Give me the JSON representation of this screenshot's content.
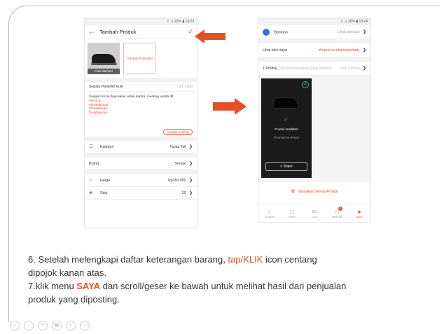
{
  "phone1": {
    "status": "⇪ ⊿ 22% ▮ 13:23",
    "title": "Tambah Produk",
    "photo_caption": "Foto Sampul",
    "add_photo_label": "+ Tambah Foto/Video",
    "product_name": "Sepatu Pantofel Kulit",
    "name_count": "21 / 100",
    "description_text": "Sangat cocok digunakan untuk kantor, meeting, pesta dll",
    "hashtags": [
      "#produk",
      "#produklokal",
      "#lewatkaupo",
      "#wajibpunya"
    ],
    "hashtag_button": "Tambah Hashtag",
    "category_label": "Kategori",
    "category_value": "Tanpa Tali",
    "brand_label": "Brand",
    "brand_value": "Senasi",
    "price_label": "Harga",
    "price_value": "Rp350.000",
    "stock_label": "Stok",
    "stock_value": "20"
  },
  "phone2": {
    "status": "⇪ ⊿ 20% ▮ 13:24",
    "help_label": "Bantuan",
    "help_link": "Lihat bantuan",
    "view_store_label": "Lihat toko saya",
    "view_store_link": "shopee.co.id/annimulanty",
    "products_label": "1 Produk",
    "products_hint": "(Jika terhubungkan yang terbaru)",
    "products_link": "Lihat Semua",
    "success_title": "Produk terdaftar!",
    "success_sub": "Promosi ke teman",
    "share_label": "Share",
    "show_all": "Tampilkan Semua Produk",
    "tabs": [
      "Beranda",
      "Promo",
      "Live",
      "Notifikasi",
      "Saya"
    ],
    "notif_count": "1"
  },
  "instructions": {
    "line1_a": "6. Setelah melengkapi daftar keterangan barang, ",
    "line1_hl": "tap/KLIK",
    "line1_b": " icon centang",
    "line2": "dipojok kanan atas.",
    "line3_a": "7.klik menu ",
    "line3_hl": "SAYA",
    "line3_b": " dan scroll/geser ke bawah untuk melihat hasil dari penjualan",
    "line4": "produk yang diposting."
  },
  "colors": {
    "accent": "#ee4d2d",
    "arrow": "#e0512a",
    "success": "#3ec46d"
  }
}
